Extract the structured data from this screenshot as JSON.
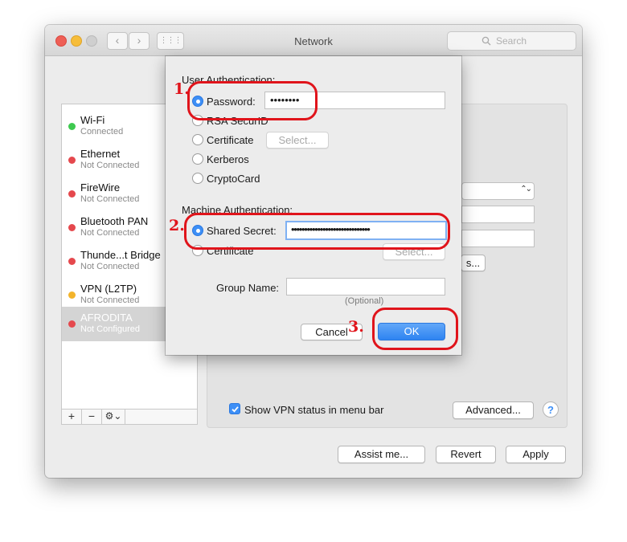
{
  "window": {
    "title": "Network",
    "search_placeholder": "Search",
    "traffic_colors": [
      "#ee5f56",
      "#f6bd3a",
      "#c5c5c5"
    ],
    "back_icon": "‹",
    "forward_icon": "›",
    "grid_icon": "⋮⋮⋮"
  },
  "sidebar": {
    "items": [
      {
        "name": "Wi-Fi",
        "status": "Connected",
        "color": "#3ec94f"
      },
      {
        "name": "Ethernet",
        "status": "Not Connected",
        "color": "#e5484d"
      },
      {
        "name": "FireWire",
        "status": "Not Connected",
        "color": "#e5484d"
      },
      {
        "name": "Bluetooth PAN",
        "status": "Not Connected",
        "color": "#e5484d"
      },
      {
        "name": "Thunde...t Bridge",
        "status": "Not Connected",
        "color": "#e5484d"
      },
      {
        "name": "VPN (L2TP)",
        "status": "Not Connected",
        "color": "#f3b42b"
      },
      {
        "name": "AFRODITA",
        "status": "Not Configured",
        "color": "#e5484d"
      }
    ],
    "selected_index": 6,
    "add_label": "+",
    "remove_label": "−",
    "action_label": "⚙⌄"
  },
  "panel": {
    "select_chevron": "⌃⌄",
    "button_partial": "s...",
    "show_vpn_label": "Show VPN status in menu bar",
    "show_vpn_checked": true,
    "advanced_label": "Advanced...",
    "help_label": "?"
  },
  "footer": {
    "assist_label": "Assist me...",
    "revert_label": "Revert",
    "apply_label": "Apply"
  },
  "sheet": {
    "user_auth_heading": "User Authentication:",
    "user_options": [
      {
        "label": "Password:",
        "selected": true
      },
      {
        "label": "RSA SecurID",
        "selected": false
      },
      {
        "label": "Certificate",
        "selected": false
      },
      {
        "label": "Kerberos",
        "selected": false
      },
      {
        "label": "CryptoCard",
        "selected": false
      }
    ],
    "password_value": "••••••••",
    "user_cert_select_label": "Select...",
    "machine_auth_heading": "Machine Authentication:",
    "machine_options": [
      {
        "label": "Shared Secret:",
        "selected": true
      },
      {
        "label": "Certificate",
        "selected": false
      }
    ],
    "shared_secret_value": "••••••••••••••••••••••••••••••",
    "machine_cert_select_label": "Select...",
    "group_name_label": "Group Name:",
    "group_name_value": "",
    "optional_hint": "(Optional)",
    "cancel_label": "Cancel",
    "ok_label": "OK",
    "accent_color": "#3d8ff6"
  },
  "annotations": {
    "step1": "1.",
    "step2": "2.",
    "step3": "3.",
    "color": "#e0141b"
  }
}
